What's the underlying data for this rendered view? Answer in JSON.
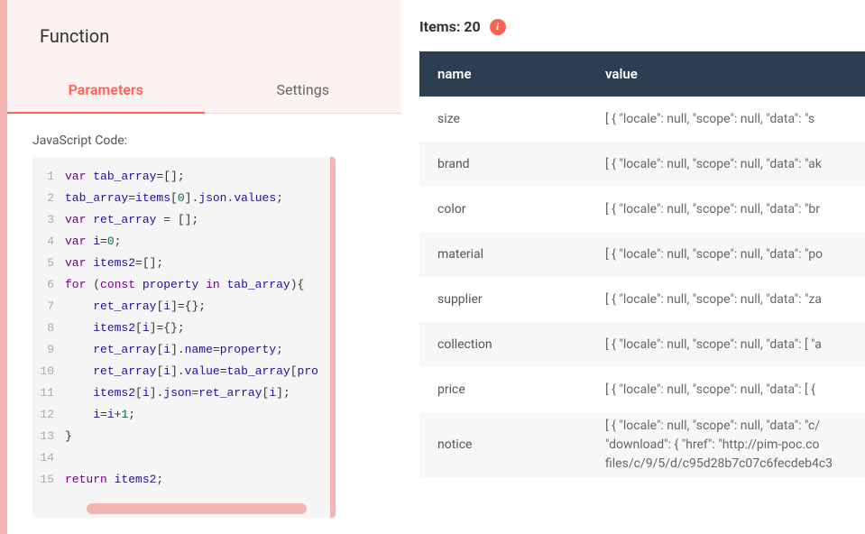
{
  "header": {
    "title": "Function"
  },
  "tabs": {
    "parameters": "Parameters",
    "settings": "Settings"
  },
  "code_label": "JavaScript Code:",
  "code": [
    [
      {
        "t": "var ",
        "c": "k"
      },
      {
        "t": "tab_array",
        "c": "b"
      },
      {
        "t": "=[];",
        "c": "p"
      }
    ],
    [
      {
        "t": "tab_array",
        "c": "b"
      },
      {
        "t": "=",
        "c": "p"
      },
      {
        "t": "items",
        "c": "b"
      },
      {
        "t": "[",
        "c": "p"
      },
      {
        "t": "0",
        "c": "num"
      },
      {
        "t": "].",
        "c": "p"
      },
      {
        "t": "json",
        "c": "n"
      },
      {
        "t": ".",
        "c": "p"
      },
      {
        "t": "values",
        "c": "n"
      },
      {
        "t": ";",
        "c": "p"
      }
    ],
    [
      {
        "t": "var ",
        "c": "k"
      },
      {
        "t": "ret_array ",
        "c": "b"
      },
      {
        "t": "= [];",
        "c": "p"
      }
    ],
    [
      {
        "t": "var ",
        "c": "k"
      },
      {
        "t": "i",
        "c": "b"
      },
      {
        "t": "=",
        "c": "p"
      },
      {
        "t": "0",
        "c": "num"
      },
      {
        "t": ";",
        "c": "p"
      }
    ],
    [
      {
        "t": "var ",
        "c": "k"
      },
      {
        "t": "items2",
        "c": "b"
      },
      {
        "t": "=[];",
        "c": "p"
      }
    ],
    [
      {
        "t": "for ",
        "c": "k"
      },
      {
        "t": "(",
        "c": "p"
      },
      {
        "t": "const ",
        "c": "k"
      },
      {
        "t": "property ",
        "c": "b"
      },
      {
        "t": "in ",
        "c": "k"
      },
      {
        "t": "tab_array",
        "c": "b"
      },
      {
        "t": "){",
        "c": "p"
      }
    ],
    [
      {
        "t": "    ",
        "c": "p"
      },
      {
        "t": "ret_array",
        "c": "b"
      },
      {
        "t": "[",
        "c": "p"
      },
      {
        "t": "i",
        "c": "b"
      },
      {
        "t": "]={};",
        "c": "p"
      }
    ],
    [
      {
        "t": "    ",
        "c": "p"
      },
      {
        "t": "items2",
        "c": "b"
      },
      {
        "t": "[",
        "c": "p"
      },
      {
        "t": "i",
        "c": "b"
      },
      {
        "t": "]={};",
        "c": "p"
      }
    ],
    [
      {
        "t": "    ",
        "c": "p"
      },
      {
        "t": "ret_array",
        "c": "b"
      },
      {
        "t": "[",
        "c": "p"
      },
      {
        "t": "i",
        "c": "b"
      },
      {
        "t": "].",
        "c": "p"
      },
      {
        "t": "name",
        "c": "n"
      },
      {
        "t": "=",
        "c": "p"
      },
      {
        "t": "property",
        "c": "b"
      },
      {
        "t": ";",
        "c": "p"
      }
    ],
    [
      {
        "t": "    ",
        "c": "p"
      },
      {
        "t": "ret_array",
        "c": "b"
      },
      {
        "t": "[",
        "c": "p"
      },
      {
        "t": "i",
        "c": "b"
      },
      {
        "t": "].",
        "c": "p"
      },
      {
        "t": "value",
        "c": "n"
      },
      {
        "t": "=",
        "c": "p"
      },
      {
        "t": "tab_array",
        "c": "b"
      },
      {
        "t": "[",
        "c": "p"
      },
      {
        "t": "pro",
        "c": "b"
      }
    ],
    [
      {
        "t": "    ",
        "c": "p"
      },
      {
        "t": "items2",
        "c": "b"
      },
      {
        "t": "[",
        "c": "p"
      },
      {
        "t": "i",
        "c": "b"
      },
      {
        "t": "].",
        "c": "p"
      },
      {
        "t": "json",
        "c": "n"
      },
      {
        "t": "=",
        "c": "p"
      },
      {
        "t": "ret_array",
        "c": "b"
      },
      {
        "t": "[",
        "c": "p"
      },
      {
        "t": "i",
        "c": "b"
      },
      {
        "t": "];",
        "c": "p"
      }
    ],
    [
      {
        "t": "    ",
        "c": "p"
      },
      {
        "t": "i",
        "c": "b"
      },
      {
        "t": "=",
        "c": "p"
      },
      {
        "t": "i",
        "c": "b"
      },
      {
        "t": "+",
        "c": "p"
      },
      {
        "t": "1",
        "c": "num"
      },
      {
        "t": ";",
        "c": "p"
      }
    ],
    [
      {
        "t": "}",
        "c": "p"
      }
    ],
    [],
    [
      {
        "t": "return ",
        "c": "k"
      },
      {
        "t": "items2",
        "c": "b"
      },
      {
        "t": ";",
        "c": "p"
      }
    ]
  ],
  "items_label": "Items: ",
  "items_count": "20",
  "table": {
    "headers": {
      "name": "name",
      "value": "value"
    },
    "rows": [
      {
        "name": "size",
        "value": "[ { \"locale\": null, \"scope\": null, \"data\": \"s"
      },
      {
        "name": "brand",
        "value": "[ { \"locale\": null, \"scope\": null, \"data\": \"ak"
      },
      {
        "name": "color",
        "value": "[ { \"locale\": null, \"scope\": null, \"data\": \"br"
      },
      {
        "name": "material",
        "value": "[ { \"locale\": null, \"scope\": null, \"data\": \"po"
      },
      {
        "name": "supplier",
        "value": "[ { \"locale\": null, \"scope\": null, \"data\": \"za"
      },
      {
        "name": "collection",
        "value": "[ { \"locale\": null, \"scope\": null, \"data\": [ \"a"
      },
      {
        "name": "price",
        "value": "[ { \"locale\": null, \"scope\": null, \"data\": [ {"
      },
      {
        "name": "notice",
        "value": "[ { \"locale\": null, \"scope\": null, \"data\": \"c/\n\"download\": { \"href\": \"http://pim-poc.co\nfiles/c/9/5/d/c95d28b7c07c6fecdeb4c3",
        "tall": true
      }
    ]
  }
}
